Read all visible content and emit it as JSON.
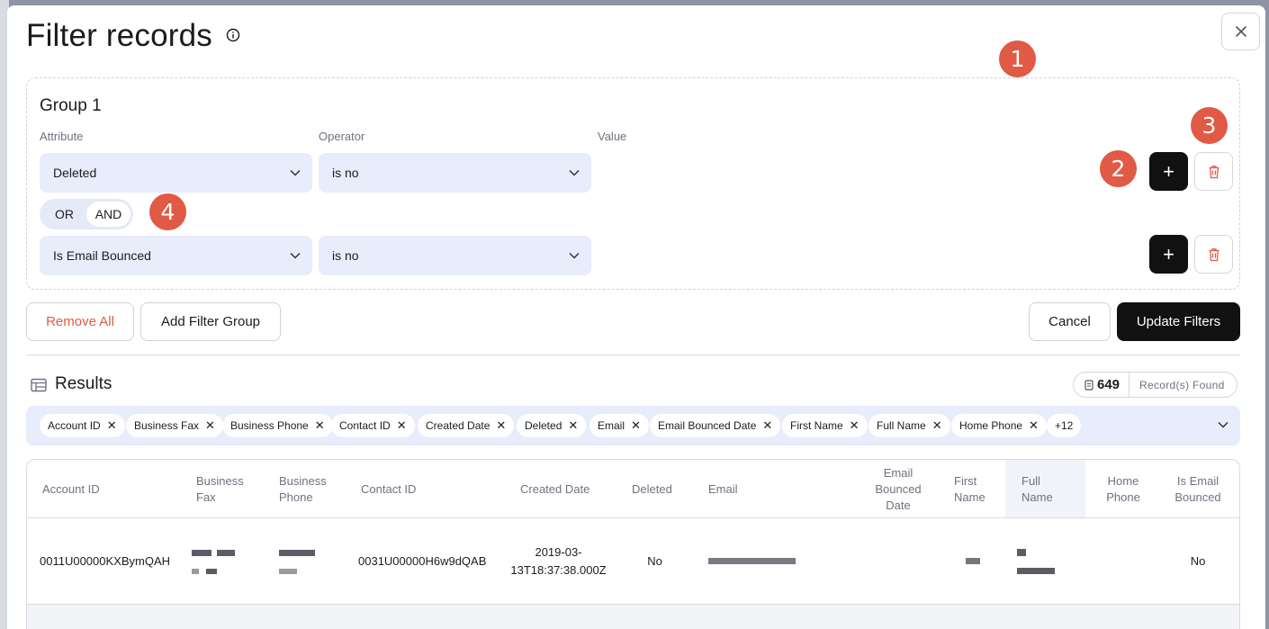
{
  "modal": {
    "title": "Filter records",
    "close_icon": "close-icon",
    "info_icon": "info-icon"
  },
  "annotations": [
    "1",
    "2",
    "3",
    "4"
  ],
  "group": {
    "title": "Group 1",
    "columns": {
      "attribute": "Attribute",
      "operator": "Operator",
      "value": "Value"
    },
    "rows": [
      {
        "attribute": "Deleted",
        "operator": "is no"
      },
      {
        "attribute": "Is Email Bounced",
        "operator": "is no"
      }
    ],
    "logic": {
      "or": "OR",
      "and": "AND",
      "selected": "AND"
    },
    "add_label": "+"
  },
  "actions": {
    "remove_all": "Remove All",
    "add_filter_group": "Add Filter Group",
    "cancel": "Cancel",
    "update": "Update Filters"
  },
  "results": {
    "title": "Results",
    "count": "649",
    "found_label": "Record(s) Found",
    "chips": [
      "Account ID",
      "Business Fax",
      "Business Phone",
      "Contact ID",
      "Created Date",
      "Deleted",
      "Email",
      "Email Bounced Date",
      "First Name",
      "Full Name",
      "Home Phone"
    ],
    "more": "+12"
  },
  "table": {
    "headers": [
      "Account ID",
      "Business Fax",
      "Business Phone",
      "Contact ID",
      "Created Date",
      "Deleted",
      "Email",
      "Email Bounced Date",
      "First Name",
      "Full Name",
      "Home Phone",
      "Is Email Bounced"
    ],
    "rows": [
      {
        "account_id": "0011U00000KXBymQAH",
        "contact_id": "0031U00000H6w9dQAB",
        "created_date": "2019-03-13T18:37:38.000Z",
        "deleted": "No",
        "is_email_bounced": "No"
      }
    ]
  },
  "colors": {
    "accent": "#e05a45",
    "primary": "#111111",
    "surface": "#e8ecfb"
  }
}
